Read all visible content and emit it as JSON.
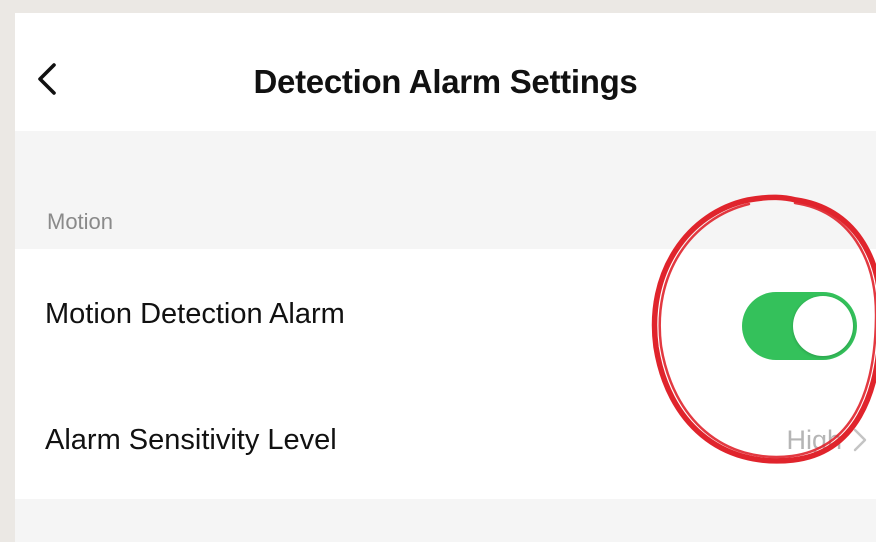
{
  "header": {
    "title": "Detection Alarm Settings",
    "back_icon": "chevron-left-icon"
  },
  "sections": [
    {
      "header": "Motion",
      "rows": [
        {
          "label": "Motion Detection Alarm",
          "control": "toggle",
          "enabled": true
        },
        {
          "label": "Alarm Sensitivity Level",
          "value": "High",
          "icon": "chevron-right-icon"
        }
      ]
    }
  ],
  "colors": {
    "toggle_on": "#34c15b",
    "annotation": "#e0242c",
    "secondary_text": "#b5b5b5"
  }
}
